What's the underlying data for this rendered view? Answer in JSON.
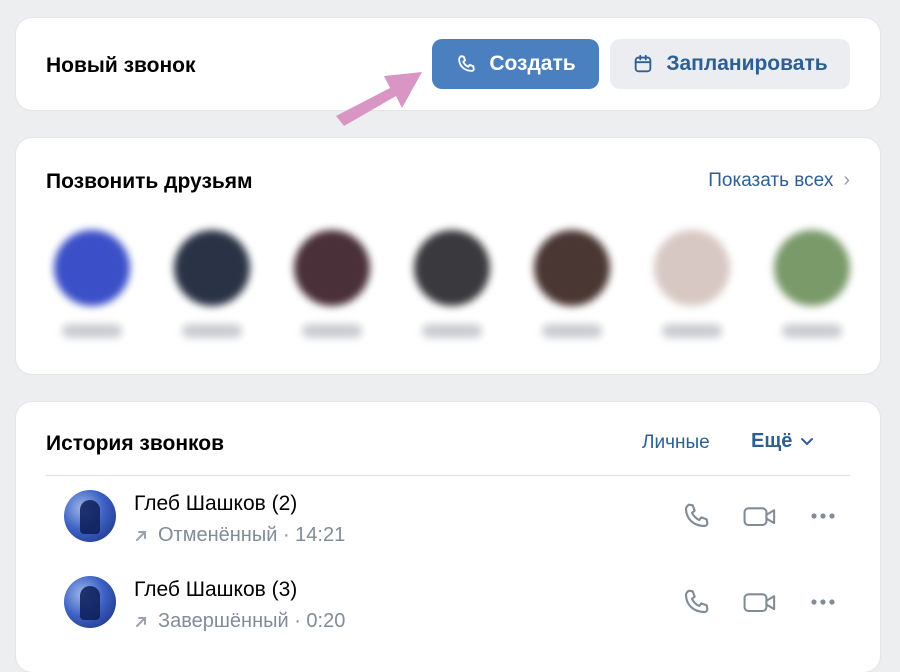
{
  "new_call": {
    "title": "Новый звонок",
    "create_label": "Создать",
    "schedule_label": "Запланировать"
  },
  "friends": {
    "title": "Позвонить друзьям",
    "show_all": "Показать всех",
    "items": [
      {
        "color": "#3b4fc8"
      },
      {
        "color": "#2a3346"
      },
      {
        "color": "#4a3038"
      },
      {
        "color": "#3a3a3e"
      },
      {
        "color": "#4a3632"
      },
      {
        "color": "#d8c8c4"
      },
      {
        "color": "#7a9a6a"
      }
    ]
  },
  "history": {
    "title": "История звонков",
    "tab_personal": "Личные",
    "tab_more": "Ещё",
    "calls": [
      {
        "name": "Глеб Шашков (2)",
        "status": "Отменённый · 14:21"
      },
      {
        "name": "Глеб Шашков (3)",
        "status": "Завершённый · 0:20"
      }
    ]
  },
  "colors": {
    "accent": "#4a80c0",
    "link": "#2d5f93",
    "muted": "#818c99",
    "background": "#edeef0",
    "arrow": "#d996c4"
  }
}
